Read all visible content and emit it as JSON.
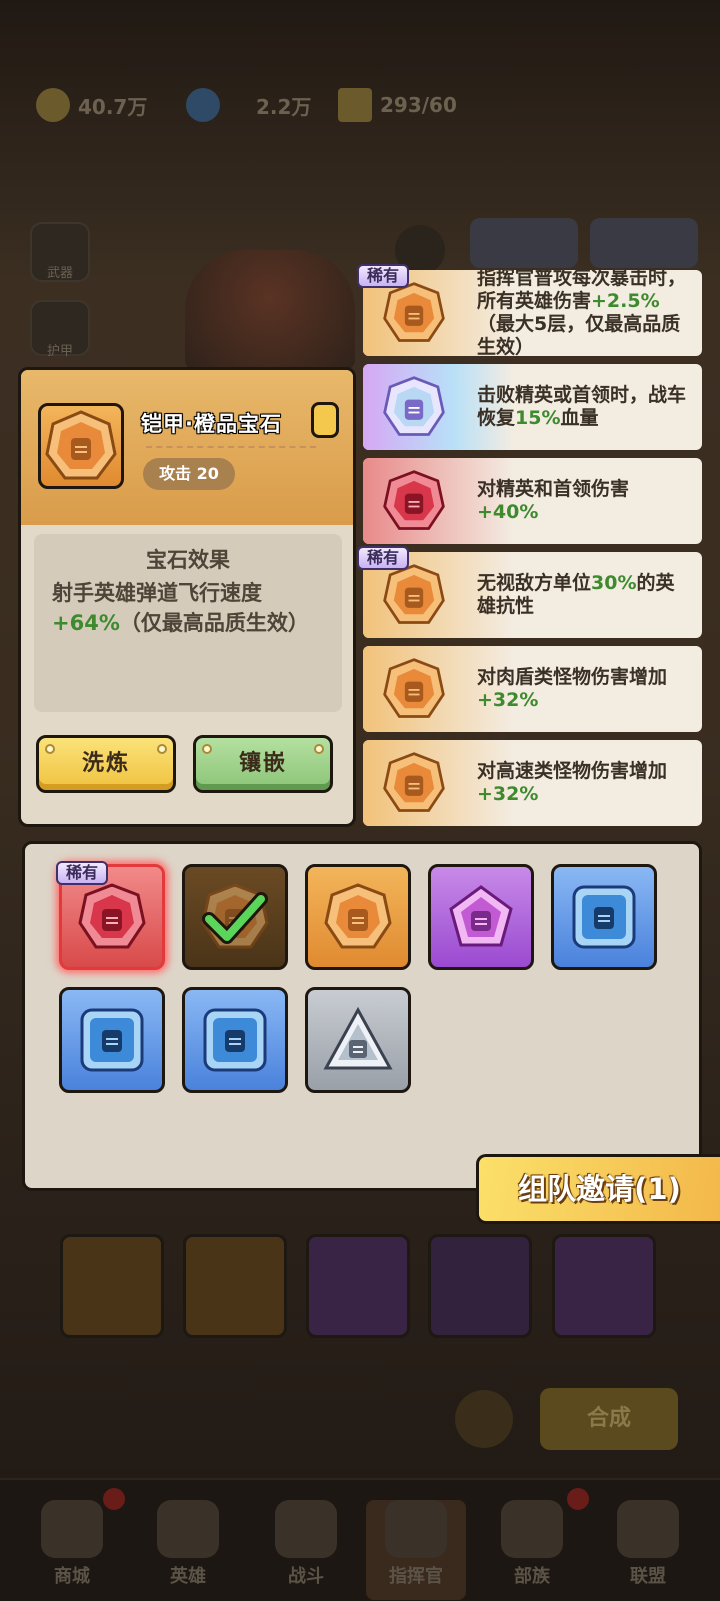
{
  "resources": [
    {
      "icon": "gold-coin-icon",
      "value": "40.7万"
    },
    {
      "icon": "diamond-icon",
      "value": "2.2万"
    },
    {
      "icon": "energy-icon",
      "value": "293/60"
    }
  ],
  "side_menu": [
    {
      "label": "武器"
    },
    {
      "label": "护甲"
    }
  ],
  "item_card": {
    "name": "铠甲·橙品宝石",
    "stat": "攻击 20",
    "effect_title": "宝石效果",
    "effect_line1": "射手英雄弹道飞行速度",
    "effect_value": "+64%",
    "effect_line2": "（仅最高品质生效）",
    "wash_label": "洗炼",
    "inlay_label": "镶嵌"
  },
  "effects": [
    {
      "rare": "稀有",
      "gem": "orange",
      "text": "指挥官普攻每次暴击时，所有英雄伤害",
      "value": "+2.5%",
      "text2": "（最大5层，仅最高品质生效）"
    },
    {
      "rare": "",
      "gem": "rainbow",
      "text": "击败精英或首领时，战车恢复",
      "value": "15%",
      "text2": "血量"
    },
    {
      "rare": "",
      "gem": "red",
      "text": "对精英和首领伤害",
      "value": "+40%",
      "text2": ""
    },
    {
      "rare": "稀有",
      "gem": "orange",
      "text": "无视敌方单位",
      "value": "30%",
      "text2": "的英雄抗性"
    },
    {
      "rare": "",
      "gem": "orange",
      "text": "对肉盾类怪物伤害增加",
      "value": "+32%",
      "text2": ""
    },
    {
      "rare": "",
      "gem": "orange",
      "text": "对高速类怪物伤害增加",
      "value": "+32%",
      "text2": ""
    }
  ],
  "inventory": [
    {
      "gem": "red",
      "rare": "稀有",
      "selected": true
    },
    {
      "gem": "orange",
      "rare": "",
      "equipped": true
    },
    {
      "gem": "orange",
      "rare": ""
    },
    {
      "gem": "purple",
      "rare": ""
    },
    {
      "gem": "blue",
      "rare": ""
    },
    {
      "gem": "blue",
      "rare": ""
    },
    {
      "gem": "blue",
      "rare": ""
    },
    {
      "gem": "grey",
      "rare": ""
    }
  ],
  "team_invite": "组队邀请(1)",
  "synth_button": "合成",
  "bottom_tabs": [
    {
      "label": "商城",
      "badge": "!"
    },
    {
      "label": "英雄",
      "badge": ""
    },
    {
      "label": "战斗",
      "badge": ""
    },
    {
      "label": "指挥官",
      "badge": ""
    },
    {
      "label": "部族",
      "badge": "!"
    },
    {
      "label": "联盟",
      "badge": ""
    }
  ],
  "colors": {
    "accent_green": "#3e8a2e",
    "card_header": "#e0a855",
    "rare_tag": "#c9b2f2"
  }
}
